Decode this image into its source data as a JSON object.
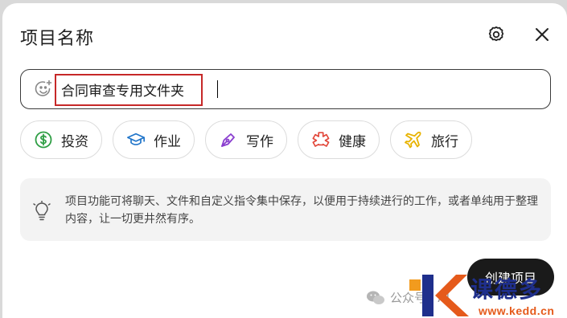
{
  "dialog": {
    "title": "项目名称",
    "settings_icon": "gear-icon",
    "close_icon": "close-icon"
  },
  "project_name": {
    "value": "合同审查专用文件夹",
    "emoji_icon": "add-emoji-icon",
    "highlight_color": "#c62828"
  },
  "templates": [
    {
      "label": "投资",
      "icon": "dollar-icon",
      "color": "#2e9e44"
    },
    {
      "label": "作业",
      "icon": "graduation-cap-icon",
      "color": "#1f74c9"
    },
    {
      "label": "写作",
      "icon": "pen-nib-icon",
      "color": "#8a3ecf"
    },
    {
      "label": "健康",
      "icon": "health-cross-icon",
      "color": "#e2473a"
    },
    {
      "label": "旅行",
      "icon": "airplane-icon",
      "color": "#e8b300"
    }
  ],
  "info": {
    "icon": "lightbulb-icon",
    "text": "项目功能可将聊天、文件和自定义指令集中保存，以便用于持续进行的工作，或者单纯用于整理内容，让一切更井然有序。"
  },
  "create_button": {
    "label": "创建项目"
  },
  "watermark": {
    "text": "公众号 · AI",
    "icon": "wechat-icon"
  },
  "site_logo": {
    "text": "www.kedd.cn",
    "brand_color": "#e55a1b"
  }
}
